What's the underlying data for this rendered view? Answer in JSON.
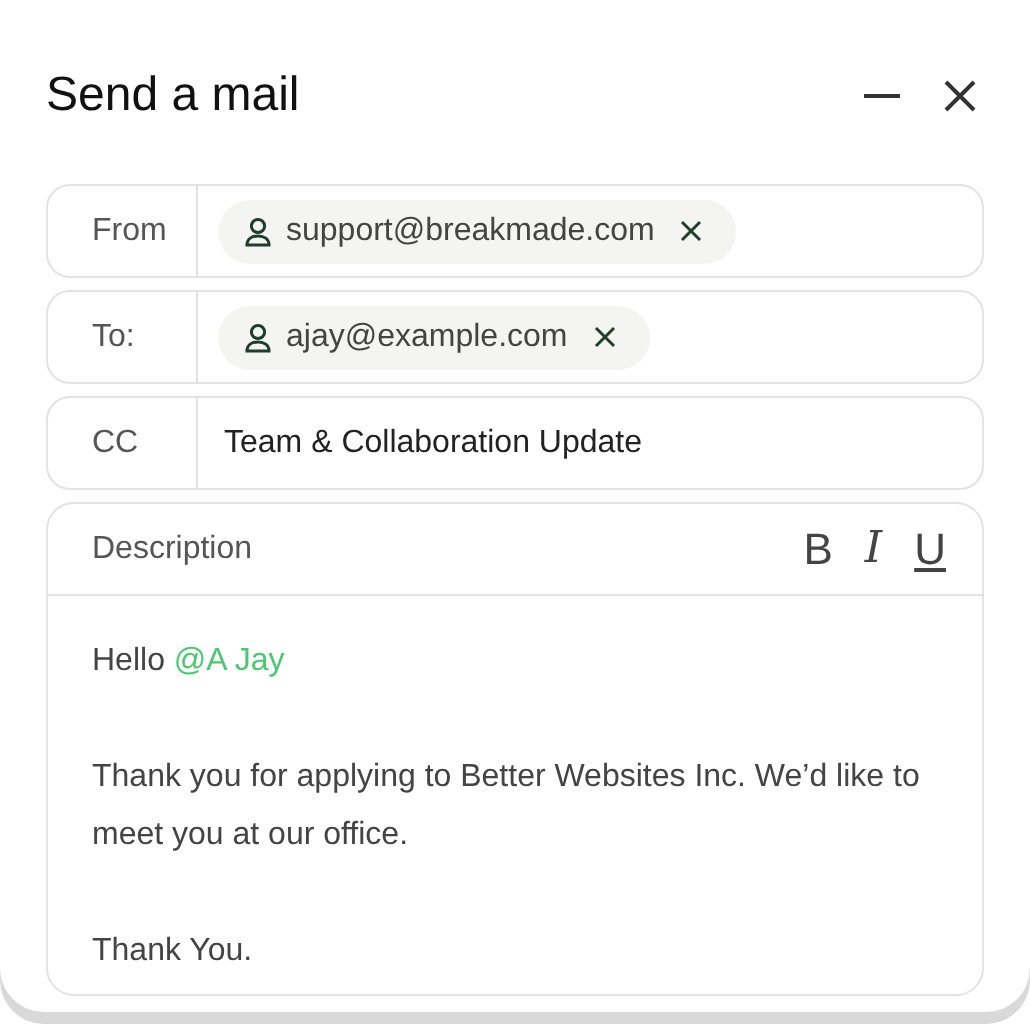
{
  "window": {
    "title": "Send a mail",
    "controls": [
      {
        "kind": "minimize"
      },
      {
        "kind": "close"
      }
    ]
  },
  "fields": [
    {
      "kind": "chips",
      "label": "From",
      "chips": [
        "support@breakmade.com"
      ]
    },
    {
      "kind": "chips",
      "label": "To:",
      "chips": [
        "ajay@example.com"
      ]
    },
    {
      "kind": "text",
      "label": "CC",
      "value": "Team & Collaboration Update"
    }
  ],
  "description": {
    "label": "Description",
    "format_buttons": [
      {
        "kind": "bold",
        "text": "B"
      },
      {
        "kind": "italic",
        "text": "I"
      },
      {
        "kind": "underline",
        "text": "U"
      }
    ],
    "paragraphs": [
      {
        "text": "Hello",
        "mention": "@A Jay"
      },
      {
        "text": "Thank you for applying to Better Websites Inc. We’d like to meet you at our office."
      },
      {
        "text": "Thank You."
      }
    ]
  }
}
